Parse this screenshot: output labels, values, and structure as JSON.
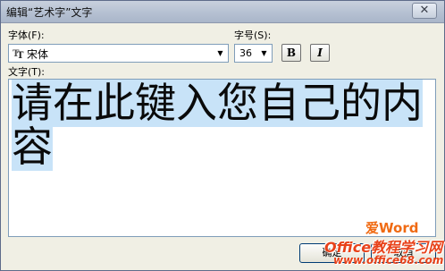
{
  "window": {
    "title": "编辑“艺术字”文字",
    "close_label": "✕"
  },
  "font": {
    "label": "字体(F):",
    "value": "宋体",
    "icon": "truetype-font-icon"
  },
  "size": {
    "label": "字号(S):",
    "value": "36"
  },
  "format_buttons": {
    "bold_label": "B",
    "italic_label": "I"
  },
  "text_area": {
    "label": "文字(T):",
    "content": "请在此键入您自己的内容"
  },
  "buttons": {
    "ok_label": "确定",
    "cancel_label": "取消"
  },
  "watermark": {
    "line1": "爱Word",
    "line2": "Office教程学习网",
    "line3": "www.office68.com"
  },
  "colors": {
    "selection": "#c8e3f8",
    "titlebar": "#b7c2d3",
    "watermark": "#e8421a"
  }
}
